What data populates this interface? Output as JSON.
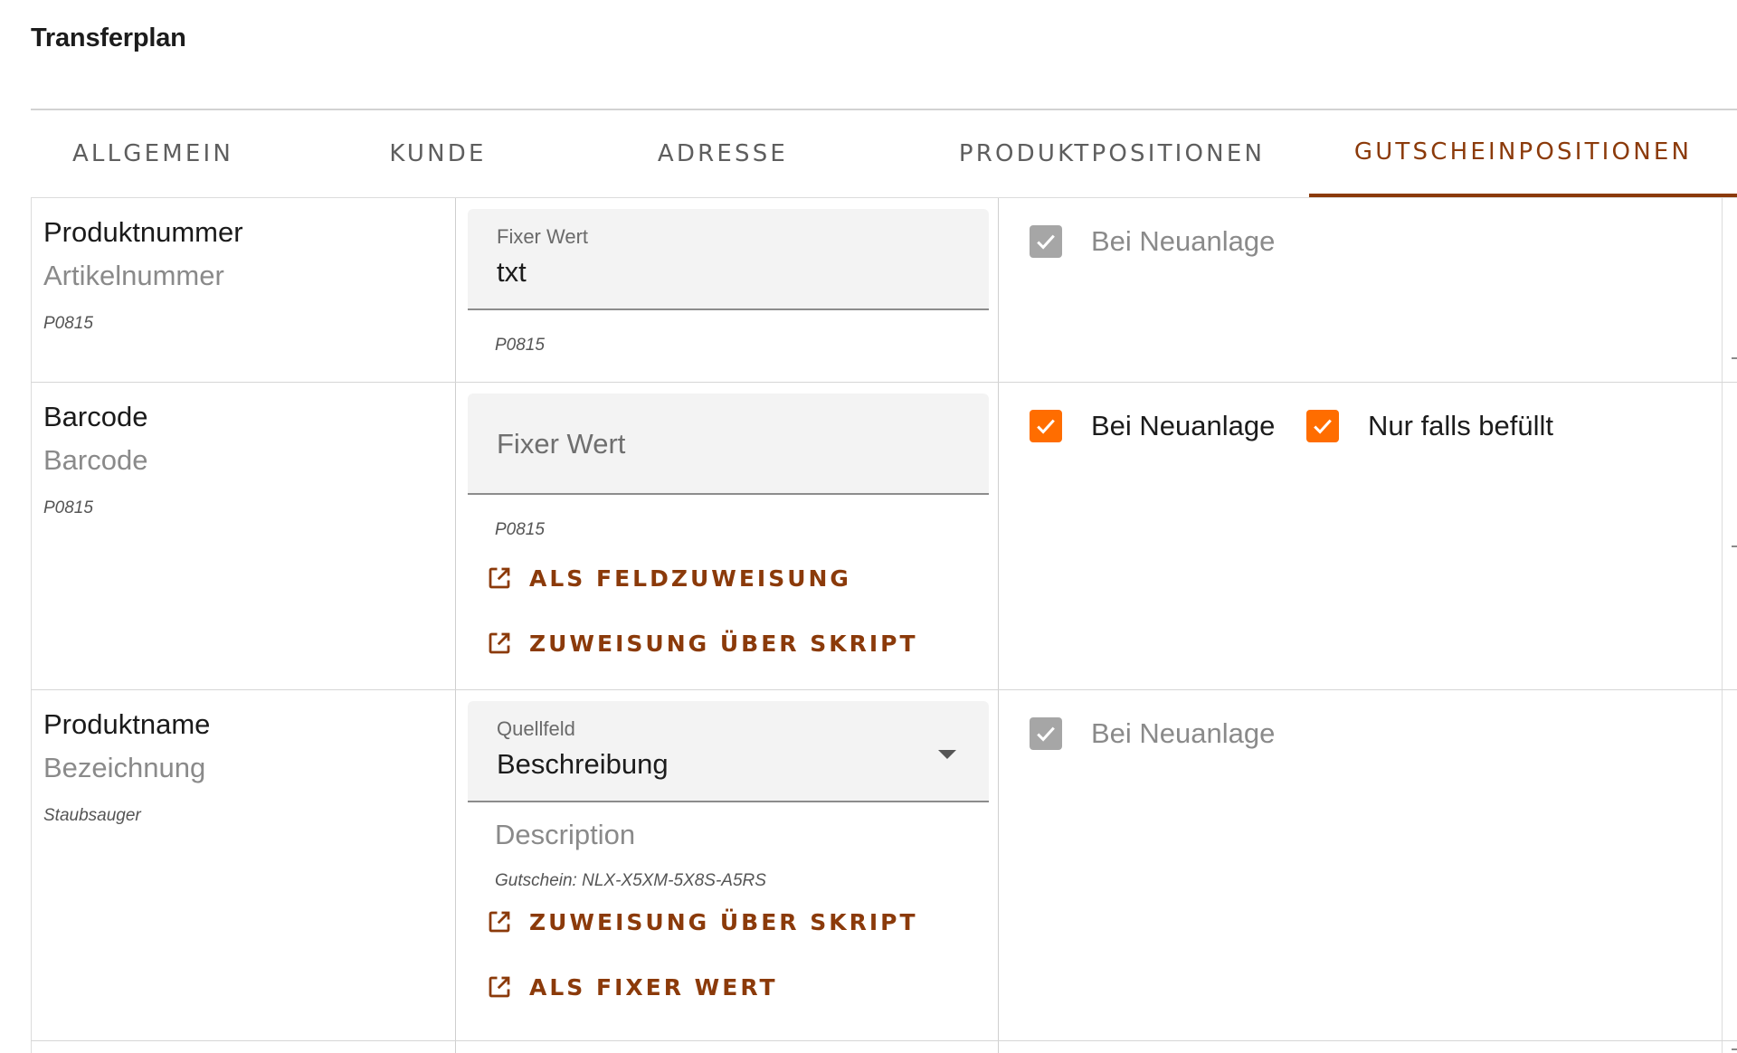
{
  "title": "Transferplan",
  "tabs": [
    {
      "label": "ALLGEMEIN",
      "active": false
    },
    {
      "label": "KUNDE",
      "active": false
    },
    {
      "label": "ADRESSE",
      "active": false
    },
    {
      "label": "PRODUKTPOSITIONEN",
      "active": false
    },
    {
      "label": "GUTSCHEINPOSITIONEN",
      "active": true
    }
  ],
  "rows": [
    {
      "name": "Produktnummer",
      "source_name": "Artikelnummer",
      "sample": "P0815",
      "input": {
        "label": "Fixer Wert",
        "value": "txt"
      },
      "hint": "P0815",
      "options": [
        {
          "label": "Bei Neuanlage",
          "checked": true,
          "disabled": true
        }
      ]
    },
    {
      "name": "Barcode",
      "source_name": "Barcode",
      "sample": "P0815",
      "input": {
        "placeholder": "Fixer Wert"
      },
      "hint": "P0815",
      "actions": [
        "ALS FELDZUWEISUNG",
        "ZUWEISUNG ÜBER SKRIPT"
      ],
      "options": [
        {
          "label": "Bei Neuanlage",
          "checked": true,
          "disabled": false
        },
        {
          "label": "Nur falls befüllt",
          "checked": true,
          "disabled": false
        }
      ]
    },
    {
      "name": "Produktname",
      "source_name": "Bezeichnung",
      "sample": "Staubsauger",
      "select": {
        "label": "Quellfeld",
        "value": "Beschreibung"
      },
      "description": "Description",
      "hint": "Gutschein: NLX-X5XM-5X8S-A5RS",
      "actions": [
        "ZUWEISUNG ÜBER SKRIPT",
        "ALS FIXER WERT"
      ],
      "options": [
        {
          "label": "Bei Neuanlage",
          "checked": true,
          "disabled": true
        }
      ]
    }
  ],
  "colors": {
    "accent": "#8b3a0a",
    "checkbox_on": "#ff6d00",
    "checkbox_disabled": "#a6a6a6"
  },
  "icons": {
    "action": "open-in-new-icon",
    "check": "check-icon",
    "dropdown": "arrow-drop-down-icon"
  }
}
